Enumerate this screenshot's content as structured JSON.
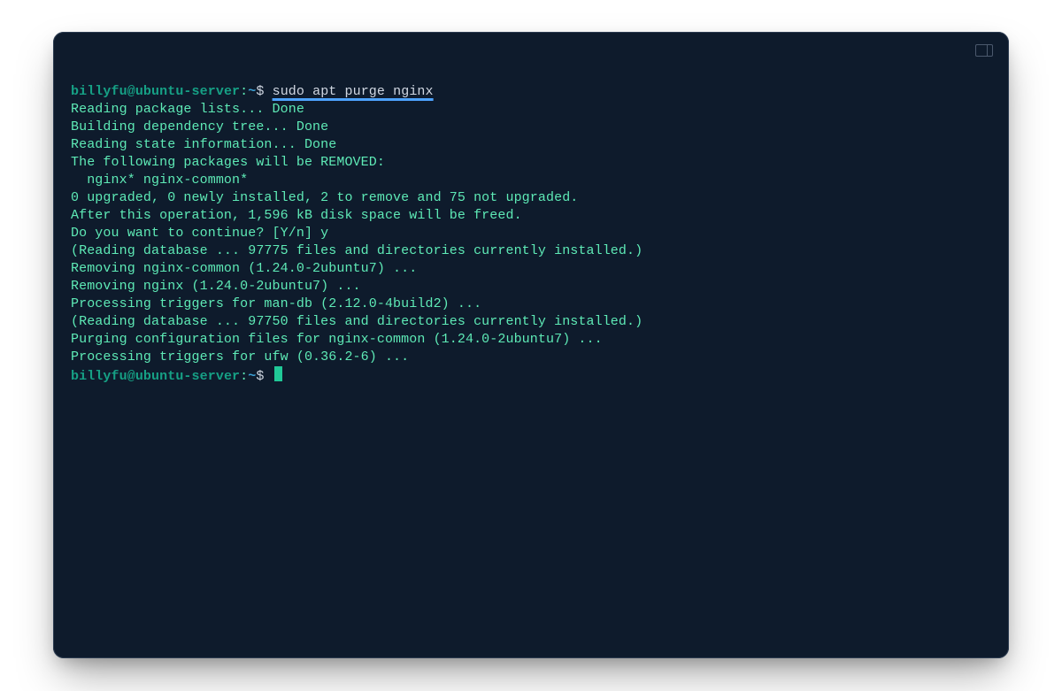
{
  "prompt": {
    "user": "billyfu",
    "host": "ubuntu-server",
    "path": "~",
    "symbol": "$"
  },
  "command": "sudo apt purge nginx",
  "output_lines": [
    "Reading package lists... Done",
    "Building dependency tree... Done",
    "Reading state information... Done",
    "The following packages will be REMOVED:",
    "  nginx* nginx-common*",
    "0 upgraded, 0 newly installed, 2 to remove and 75 not upgraded.",
    "After this operation, 1,596 kB disk space will be freed.",
    "Do you want to continue? [Y/n] y",
    "(Reading database ... 97775 files and directories currently installed.)",
    "Removing nginx-common (1.24.0-2ubuntu7) ...",
    "Removing nginx (1.24.0-2ubuntu7) ...",
    "Processing triggers for man-db (2.12.0-4build2) ...",
    "(Reading database ... 97750 files and directories currently installed.)",
    "Purging configuration files for nginx-common (1.24.0-2ubuntu7) ...",
    "Processing triggers for ufw (0.36.2-6) ..."
  ],
  "colors": {
    "window_bg": "#0e1b2c",
    "prompt_user": "#16a085",
    "prompt_path": "#3da2d6",
    "output_text": "#5eeab6",
    "command_text": "#d0d7e2",
    "underline": "#4da3ff",
    "cursor": "#20c997"
  }
}
